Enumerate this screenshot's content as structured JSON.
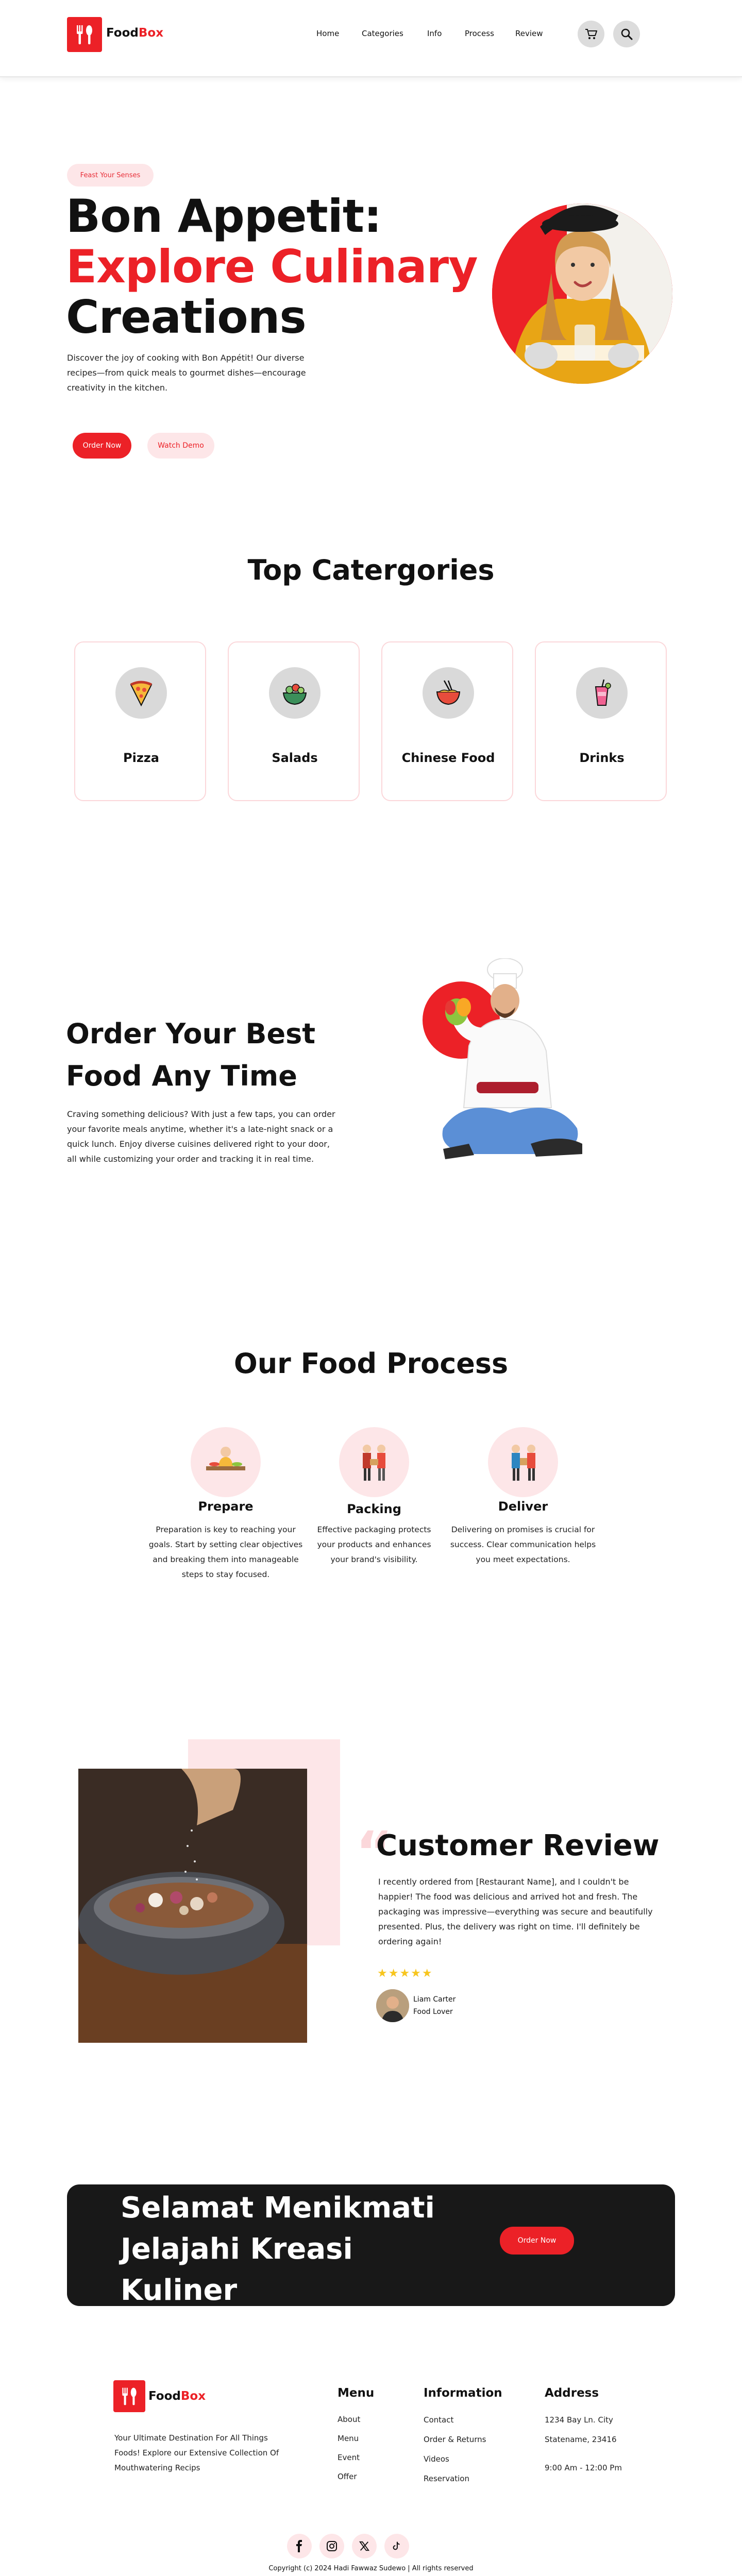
{
  "brand": {
    "name_first": "Food",
    "name_second": "Box",
    "accent": "#ec2127",
    "pink": "#fde6e8"
  },
  "nav": {
    "items": [
      "Home",
      "Categories",
      "Info",
      "Process",
      "Review"
    ],
    "cart_icon": "cart-icon",
    "search_icon": "search-icon"
  },
  "hero": {
    "badge": "Feast Your Senses",
    "title_line1": "Bon Appetit:",
    "title_line2": "Explore Culinary",
    "title_line3": "Creations",
    "description": "Discover the joy of cooking with Bon Appétit! Our diverse recipes—from quick meals to gourmet dishes—encourage creativity in the kitchen.",
    "order_button": "Order Now",
    "demo_button": "Watch Demo"
  },
  "categories": {
    "title": "Top Catergories",
    "items": [
      {
        "label": "Pizza",
        "icon": "pizza-icon"
      },
      {
        "label": "Salads",
        "icon": "salad-icon"
      },
      {
        "label": "Chinese Food",
        "icon": "noodle-bowl-icon"
      },
      {
        "label": "Drinks",
        "icon": "drink-icon"
      }
    ]
  },
  "order_section": {
    "title_line1": "Order Your Best",
    "title_line2": "Food Any Time",
    "description": "Craving something delicious? With just a few taps, you can order your favorite meals anytime, whether it's a late-night snack or a quick lunch. Enjoy diverse cuisines delivered right to your door, all while customizing your order and tracking it in real time."
  },
  "process": {
    "title": "Our Food Process",
    "steps": [
      {
        "title": "Prepare",
        "description": "Preparation is key to reaching your goals. Start by setting clear objectives and breaking them into manageable steps to stay focused."
      },
      {
        "title": "Packing",
        "description": "Effective packaging protects your products and enhances your brand's visibility."
      },
      {
        "title": "Deliver",
        "description": "Delivering on promises is crucial for success. Clear communication helps you meet expectations."
      }
    ]
  },
  "review": {
    "title": "Customer Review",
    "quote_mark": "“",
    "text": "I recently ordered from [Restaurant Name], and I couldn't be happier! The food was delicious and arrived hot and fresh. The packaging was impressive—everything was secure and beautifully presented. Plus, the delivery was right on time. I'll definitely be ordering again!",
    "stars": "★★★★★",
    "rating": 5,
    "reviewer_name": "Liam Carter",
    "reviewer_role": "Food Lover"
  },
  "banner": {
    "line1": "Selamat Menikmati",
    "line2": "Jelajahi Kreasi",
    "line3": "Kuliner",
    "button": "Order Now"
  },
  "footer": {
    "tagline": "Your Ultimate Destination For All Things Foods! Explore our Extensive Collection Of Mouthwatering Recips",
    "menu": {
      "title": "Menu",
      "items": [
        "About",
        "Menu",
        "Event",
        "Offer"
      ]
    },
    "information": {
      "title": "Information",
      "items": [
        "Contact",
        "Order & Returns",
        "Videos",
        "Reservation"
      ]
    },
    "address": {
      "title": "Address",
      "items": [
        "1234 Bay Ln. City",
        "Statename, 23416",
        "9:00 Am - 12:00 Pm"
      ]
    },
    "social": [
      "facebook-icon",
      "instagram-icon",
      "x-icon",
      "tiktok-icon"
    ],
    "copyright": "Copyright (c) 2024 Hadi Fawwaz Sudewo | All rights reserved"
  }
}
